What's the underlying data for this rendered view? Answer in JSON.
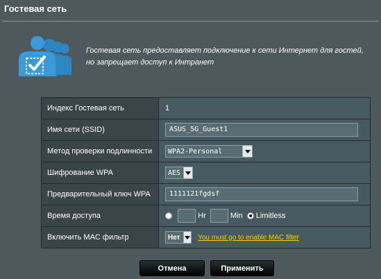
{
  "page": {
    "title": "Гостевая сеть",
    "description_line1": "Гостевая сеть предоставляет подключение к сети Интернет для гостей,",
    "description_line2": "но запрещает доступ к Интранет"
  },
  "form": {
    "index": {
      "label": "Индекс Гостевая сеть",
      "value": "1"
    },
    "ssid": {
      "label": "Имя сети (SSID)",
      "value": "ASUS_5G_Guest1"
    },
    "auth": {
      "label": "Метод проверки подлинности",
      "value": "WPA2-Personal"
    },
    "encryption": {
      "label": "Шифрование WPA",
      "value": "AES"
    },
    "psk": {
      "label": "Предварительный ключ WPA",
      "value": "1111121fgdsf"
    },
    "access_time": {
      "label": "Время доступа",
      "hr_label": "Hr",
      "min_label": "Min",
      "limitless_label": "Limitless",
      "selected": "Limitless"
    },
    "mac_filter": {
      "label": "Включить MAC фильтр",
      "value": "Нет",
      "link": "You must go to enable MAC filter"
    }
  },
  "buttons": {
    "cancel": "Отмена",
    "apply": "Применить"
  },
  "colors": {
    "background": "#4d595d",
    "label_cell": "#3a4548",
    "value_cell": "#475a5f",
    "link": "#ffcc00",
    "icon": "#2e86c1"
  },
  "icons": {
    "guest": "guest-users-checkbox-icon",
    "dropdown": "chevron-down-icon"
  }
}
